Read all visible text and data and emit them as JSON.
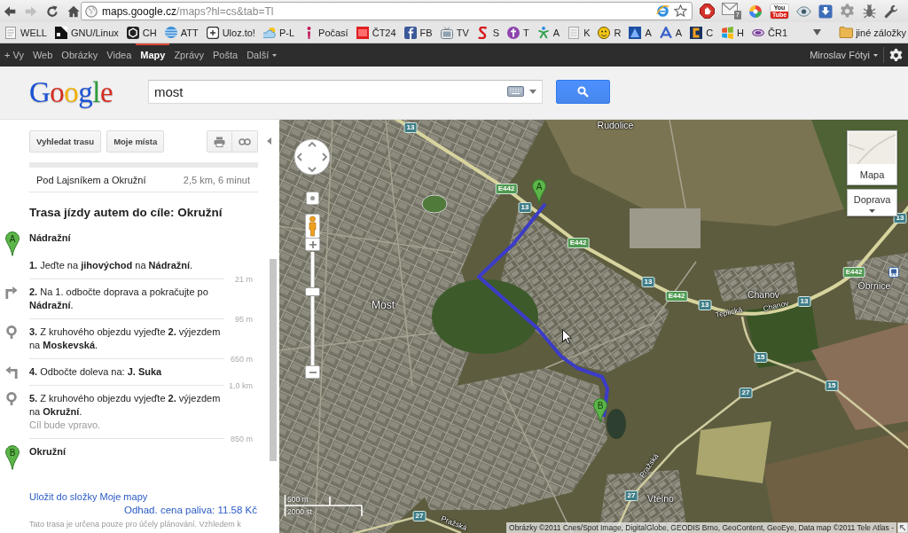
{
  "browser": {
    "nav": [
      {
        "kind": "back",
        "disabled": false
      },
      {
        "kind": "forward",
        "disabled": true
      },
      {
        "kind": "reload",
        "disabled": false
      },
      {
        "kind": "home",
        "disabled": false
      }
    ],
    "address": {
      "host": "maps.google.cz",
      "path": "/maps?hl=cs&tab=Tl"
    },
    "mail_badge": "7",
    "video_logo": [
      "You",
      "Tube"
    ]
  },
  "bookmarks": {
    "items": [
      {
        "label": "WELL"
      },
      {
        "label": "GNU/Linux"
      },
      {
        "label": "CH"
      },
      {
        "label": "ATT"
      },
      {
        "label": "Uloz.to!"
      },
      {
        "label": "P-L"
      },
      {
        "label": "Počasí"
      },
      {
        "label": "ČT24"
      },
      {
        "label": "FB"
      },
      {
        "label": "TV"
      },
      {
        "label": "S"
      },
      {
        "label": "T"
      },
      {
        "label": "A"
      },
      {
        "label": "K"
      },
      {
        "label": "R"
      },
      {
        "label": "A"
      },
      {
        "label": "A"
      },
      {
        "label": "C"
      },
      {
        "label": "H"
      },
      {
        "label": "ČR1"
      }
    ],
    "other": "jiné záložky"
  },
  "google_bar": {
    "items": [
      {
        "label": "+ Vy",
        "selected": false,
        "dropdown": false
      },
      {
        "label": "Web",
        "selected": false,
        "dropdown": false
      },
      {
        "label": "Obrázky",
        "selected": false,
        "dropdown": false
      },
      {
        "label": "Videa",
        "selected": false,
        "dropdown": false
      },
      {
        "label": "Mapy",
        "selected": true,
        "dropdown": false
      },
      {
        "label": "Zprávy",
        "selected": false,
        "dropdown": false
      },
      {
        "label": "Pošta",
        "selected": false,
        "dropdown": false
      },
      {
        "label": "Další",
        "selected": false,
        "dropdown": true
      }
    ],
    "user": "Miroslav Fótyi"
  },
  "header": {
    "logo": "Google",
    "search": {
      "value": "most"
    }
  },
  "panel": {
    "buttons": [
      {
        "label": "Vyhledat trasu"
      },
      {
        "label": "Moje místa"
      }
    ],
    "route_option": {
      "name": "Pod Lajsníkem a Okružní",
      "summary": "2,5 km, 6 minut"
    },
    "title": "Trasa jízdy autem do cíle: Okružní",
    "start": {
      "letter": "A",
      "name": "Nádražní"
    },
    "steps": [
      {
        "kind": "depart",
        "text": "**1.** Jeďte na **jihovýchod** na **Nádražní**.",
        "distance": "21 m"
      },
      {
        "kind": "right",
        "text": "**2.** Na 1. odbočte doprava a pokračujte po **Nádražní**.",
        "distance": "95 m"
      },
      {
        "kind": "roundabout",
        "text": "**3.** Z kruhového objezdu vyjeďte **2.** výjezdem na **Moskevská**.",
        "distance": "650 m"
      },
      {
        "kind": "left",
        "text": "**4.** Odbočte doleva na: **J. Suka**",
        "distance": "1,0 km"
      },
      {
        "kind": "roundabout",
        "text": "**5.** Z kruhového objezdu vyjeďte **2.** výjezdem na **Okružní**.",
        "note": "Cíl bude vpravo.",
        "distance": "850 m"
      }
    ],
    "end": {
      "letter": "B",
      "name": "Okružní"
    },
    "save_link": "Uložit do složky Moje mapy",
    "fuel_link": "Odhad. cena paliva: 11.58 Kč",
    "disclaimer": "Tato trasa je určena pouze pro účely plánování. Vzhledem k"
  },
  "map": {
    "labels": [
      {
        "text": "Rudolice",
        "kind": "place"
      },
      {
        "text": "Obrnice",
        "kind": "place"
      },
      {
        "text": "Chanov",
        "kind": "place"
      },
      {
        "text": "Most",
        "kind": "city"
      },
      {
        "text": "Teplická",
        "kind": "street"
      },
      {
        "text": "Chanov",
        "kind": "street"
      },
      {
        "text": "Pražská",
        "kind": "street"
      },
      {
        "text": "Vtelno",
        "kind": "place"
      },
      {
        "text": "Pražská",
        "kind": "street"
      }
    ],
    "shields": [
      {
        "text": "13",
        "kind": "national"
      },
      {
        "text": "E442",
        "kind": "european"
      },
      {
        "text": "13",
        "kind": "national"
      },
      {
        "text": "13",
        "kind": "national"
      },
      {
        "text": "E442",
        "kind": "european"
      },
      {
        "text": "E442",
        "kind": "european"
      },
      {
        "text": "13",
        "kind": "national"
      },
      {
        "text": "E442",
        "kind": "european"
      },
      {
        "text": "13",
        "kind": "national"
      },
      {
        "text": "13",
        "kind": "national"
      },
      {
        "text": "15",
        "kind": "national"
      },
      {
        "text": "15",
        "kind": "national"
      },
      {
        "text": "27",
        "kind": "national"
      },
      {
        "text": "27",
        "kind": "national"
      },
      {
        "text": "27",
        "kind": "national"
      }
    ],
    "markers": [
      {
        "letter": "A"
      },
      {
        "letter": "B"
      }
    ],
    "zoom": {
      "level": 0.66
    },
    "map_types": [
      {
        "label": "Mapa",
        "kind": "thumbnail"
      },
      {
        "label": "Doprava",
        "kind": "dropdown"
      }
    ],
    "scale": {
      "metric": "500 m",
      "imperial": "2000 st."
    },
    "copyright": "Obrázky ©2011 Cnes/Spot Image, DigitalGlobe, GEODIS Brno, GeoContent, GeoEye, Data map ©2011 Tele Atlas -"
  }
}
